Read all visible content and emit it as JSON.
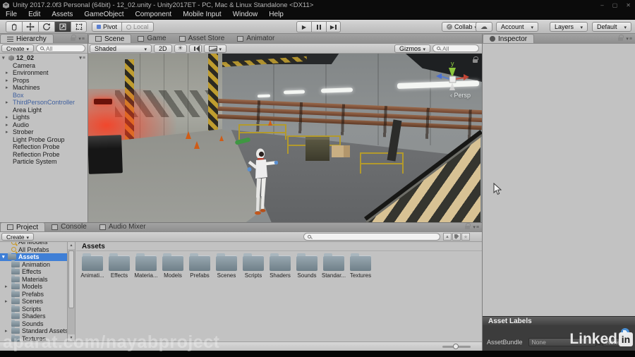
{
  "title_bar": {
    "title": "Unity 2017.2.0f3 Personal (64bit) - 12_02.unity - Unity2017ET - PC, Mac & Linux Standalone <DX11>",
    "minimize": "–",
    "maximize": "▢",
    "close": "✕"
  },
  "menu": {
    "items": [
      "File",
      "Edit",
      "Assets",
      "GameObject",
      "Component",
      "Mobile Input",
      "Window",
      "Help"
    ]
  },
  "toolbar": {
    "pivot": "Pivot",
    "local": "Local",
    "collab": "Collab",
    "account": "Account",
    "layers": "Layers",
    "layout": "Default"
  },
  "icons": {
    "dropdown": "▾",
    "tree_closed": "▸",
    "tree_open": "▾",
    "play": "▶",
    "sun": "☀",
    "cloud": "☁",
    "star": "★",
    "check": "✓",
    "persp_arrow": "‹",
    "scroll_up": "▴",
    "scroll_down": "▾",
    "hash": "#",
    "tri_small": "▲"
  },
  "hierarchy": {
    "tab": "Hierarchy",
    "create": "Create",
    "search": "All",
    "root": "12_02",
    "items": [
      {
        "label": "Camera"
      },
      {
        "label": "Environment",
        "arrow": true
      },
      {
        "label": "Props",
        "arrow": true
      },
      {
        "label": "Machines",
        "arrow": true
      },
      {
        "label": "Box",
        "blue": true
      },
      {
        "label": "ThirdPersonController",
        "arrow": true,
        "blue": true
      },
      {
        "label": "Area Light"
      },
      {
        "label": "Lights",
        "arrow": true
      },
      {
        "label": "Audio",
        "arrow": true
      },
      {
        "label": "Strober",
        "arrow": true
      },
      {
        "label": "Light Probe Group"
      },
      {
        "label": "Reflection Probe"
      },
      {
        "label": "Reflection Probe"
      },
      {
        "label": "Particle System"
      }
    ]
  },
  "scene": {
    "tabs": [
      {
        "label": "Scene",
        "active": true
      },
      {
        "label": "Game"
      },
      {
        "label": "Asset Store"
      },
      {
        "label": "Animator"
      }
    ],
    "shaded": "Shaded",
    "two_d": "2D",
    "gizmos": "Gizmos",
    "search": "All",
    "persp": "Persp",
    "axis_y": "y"
  },
  "inspector": {
    "tab": "Inspector"
  },
  "project": {
    "tabs": [
      {
        "label": "Project",
        "active": true
      },
      {
        "label": "Console"
      },
      {
        "label": "Audio Mixer"
      }
    ],
    "create": "Create",
    "favorites": [
      {
        "label": "All Models"
      },
      {
        "label": "All Prefabs"
      }
    ],
    "root": "Assets",
    "tree": [
      {
        "label": "Animation"
      },
      {
        "label": "Effects"
      },
      {
        "label": "Materials"
      },
      {
        "label": "Models",
        "arrow": true
      },
      {
        "label": "Prefabs"
      },
      {
        "label": "Scenes",
        "arrow": true
      },
      {
        "label": "Scripts"
      },
      {
        "label": "Shaders"
      },
      {
        "label": "Sounds"
      },
      {
        "label": "Standard Assets",
        "arrow": true
      },
      {
        "label": "Textures"
      }
    ],
    "grid_header": "Assets",
    "folders": [
      "Animati...",
      "Effects",
      "Materia...",
      "Models",
      "Prefabs",
      "Scenes",
      "Scripts",
      "Shaders",
      "Sounds",
      "Standar...",
      "Textures"
    ]
  },
  "asset_labels": {
    "header": "Asset Labels",
    "bundle_label": "AssetBundle",
    "bundle_value": "None",
    "variant_value": "None"
  },
  "watermark": {
    "aparat": "aparat.com/nayabproject",
    "linkedin_text": "Linked",
    "linkedin_badge": "in"
  },
  "colors": {
    "selection": "#3f7fd6",
    "prefab_text": "#3e5f9e",
    "label_icon": "#4a8fd4"
  }
}
